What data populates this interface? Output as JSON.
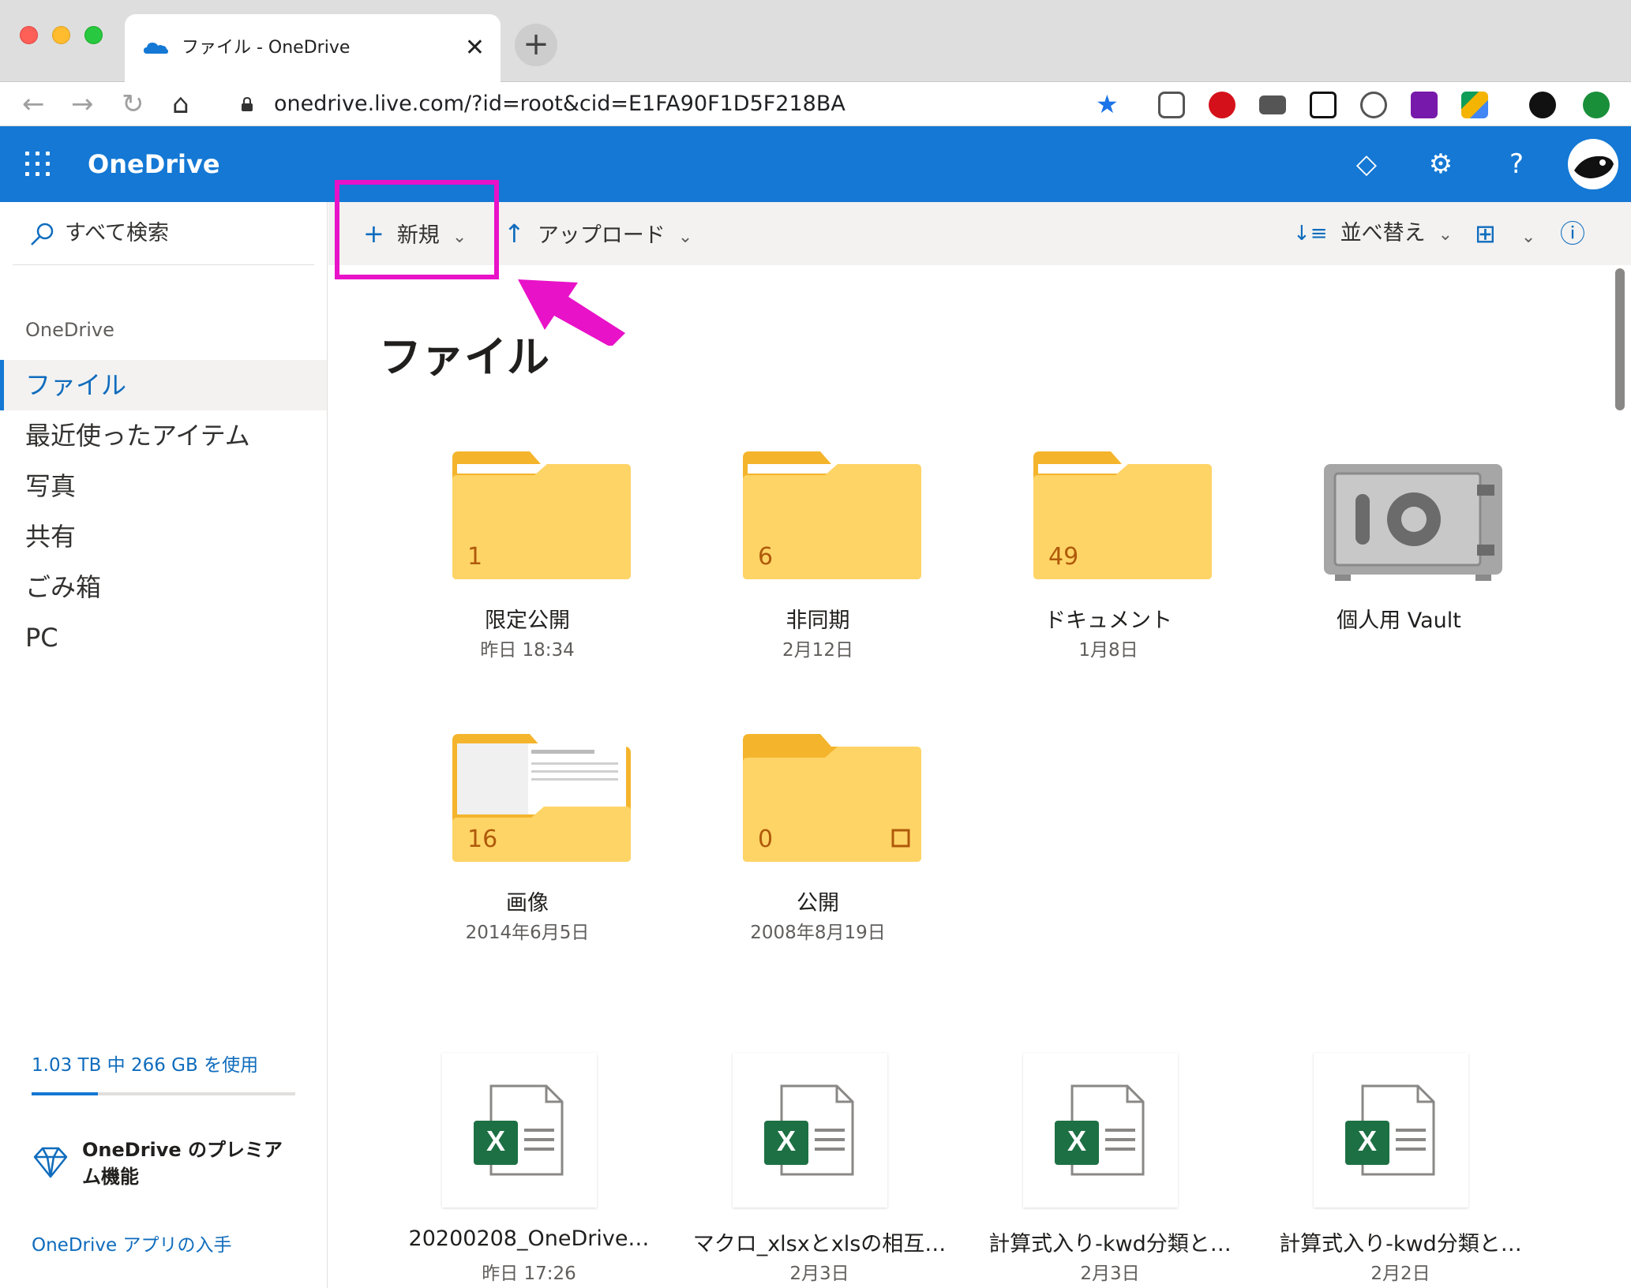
{
  "browser": {
    "tab_title": "ファイル - OneDrive",
    "tab_close": "✕",
    "new_tab": "+",
    "url": "onedrive.live.com/?id=root&cid=E1FA90F1D5F218BA",
    "nav_back": "←",
    "nav_forward": "→",
    "nav_reload": "↻",
    "nav_home": "⌂",
    "bookmark_star": "★"
  },
  "header": {
    "brand": "OneDrive",
    "diamond_icon": "◇",
    "settings_icon": "⚙",
    "help_icon": "?"
  },
  "sidebar": {
    "search_label": "すべて検索",
    "section": "OneDrive",
    "items": [
      {
        "label": "ファイル",
        "active": true
      },
      {
        "label": "最近使ったアイテム"
      },
      {
        "label": "写真"
      },
      {
        "label": "共有"
      },
      {
        "label": "ごみ箱"
      },
      {
        "label": "PC"
      }
    ],
    "quota_text": "1.03 TB 中 266 GB を使用",
    "quota_used_fraction": 0.25,
    "premium_label": "OneDrive のプレミアム機能",
    "get_app": "OneDrive アプリの入手"
  },
  "commandbar": {
    "new_icon": "+",
    "new_label": "新規",
    "upload_icon": "↑",
    "upload_label": "アップロード",
    "sort_icon": "↓≡",
    "sort_label": "並べ替え",
    "view_icon": "⊞",
    "info_icon": "ⓘ",
    "chevron": "⌄"
  },
  "main": {
    "title": "ファイル",
    "folders": [
      {
        "name": "限定公開",
        "date": "昨日 18:34",
        "count": "1"
      },
      {
        "name": "非同期",
        "date": "2月12日",
        "count": "6"
      },
      {
        "name": "ドキュメント",
        "date": "1月8日",
        "count": "49"
      },
      {
        "name": "個人用 Vault",
        "date": "",
        "count": ""
      },
      {
        "name": "画像",
        "date": "2014年6月5日",
        "count": "16"
      },
      {
        "name": "公開",
        "date": "2008年8月19日",
        "count": "0"
      }
    ],
    "files": [
      {
        "name": "20200208_OneDrive…",
        "date": "昨日 17:26"
      },
      {
        "name": "マクロ_xlsxとxlsの相互…",
        "date": "2月3日"
      },
      {
        "name": "計算式入り-kwd分類と…",
        "date": "2月3日"
      },
      {
        "name": "計算式入り-kwd分類と…",
        "date": "2月2日"
      }
    ]
  },
  "colors": {
    "brand_blue": "#1478d4",
    "highlight_magenta": "#e812c8",
    "folder_yellow": "#ffd466",
    "excel_green": "#1d7044"
  }
}
